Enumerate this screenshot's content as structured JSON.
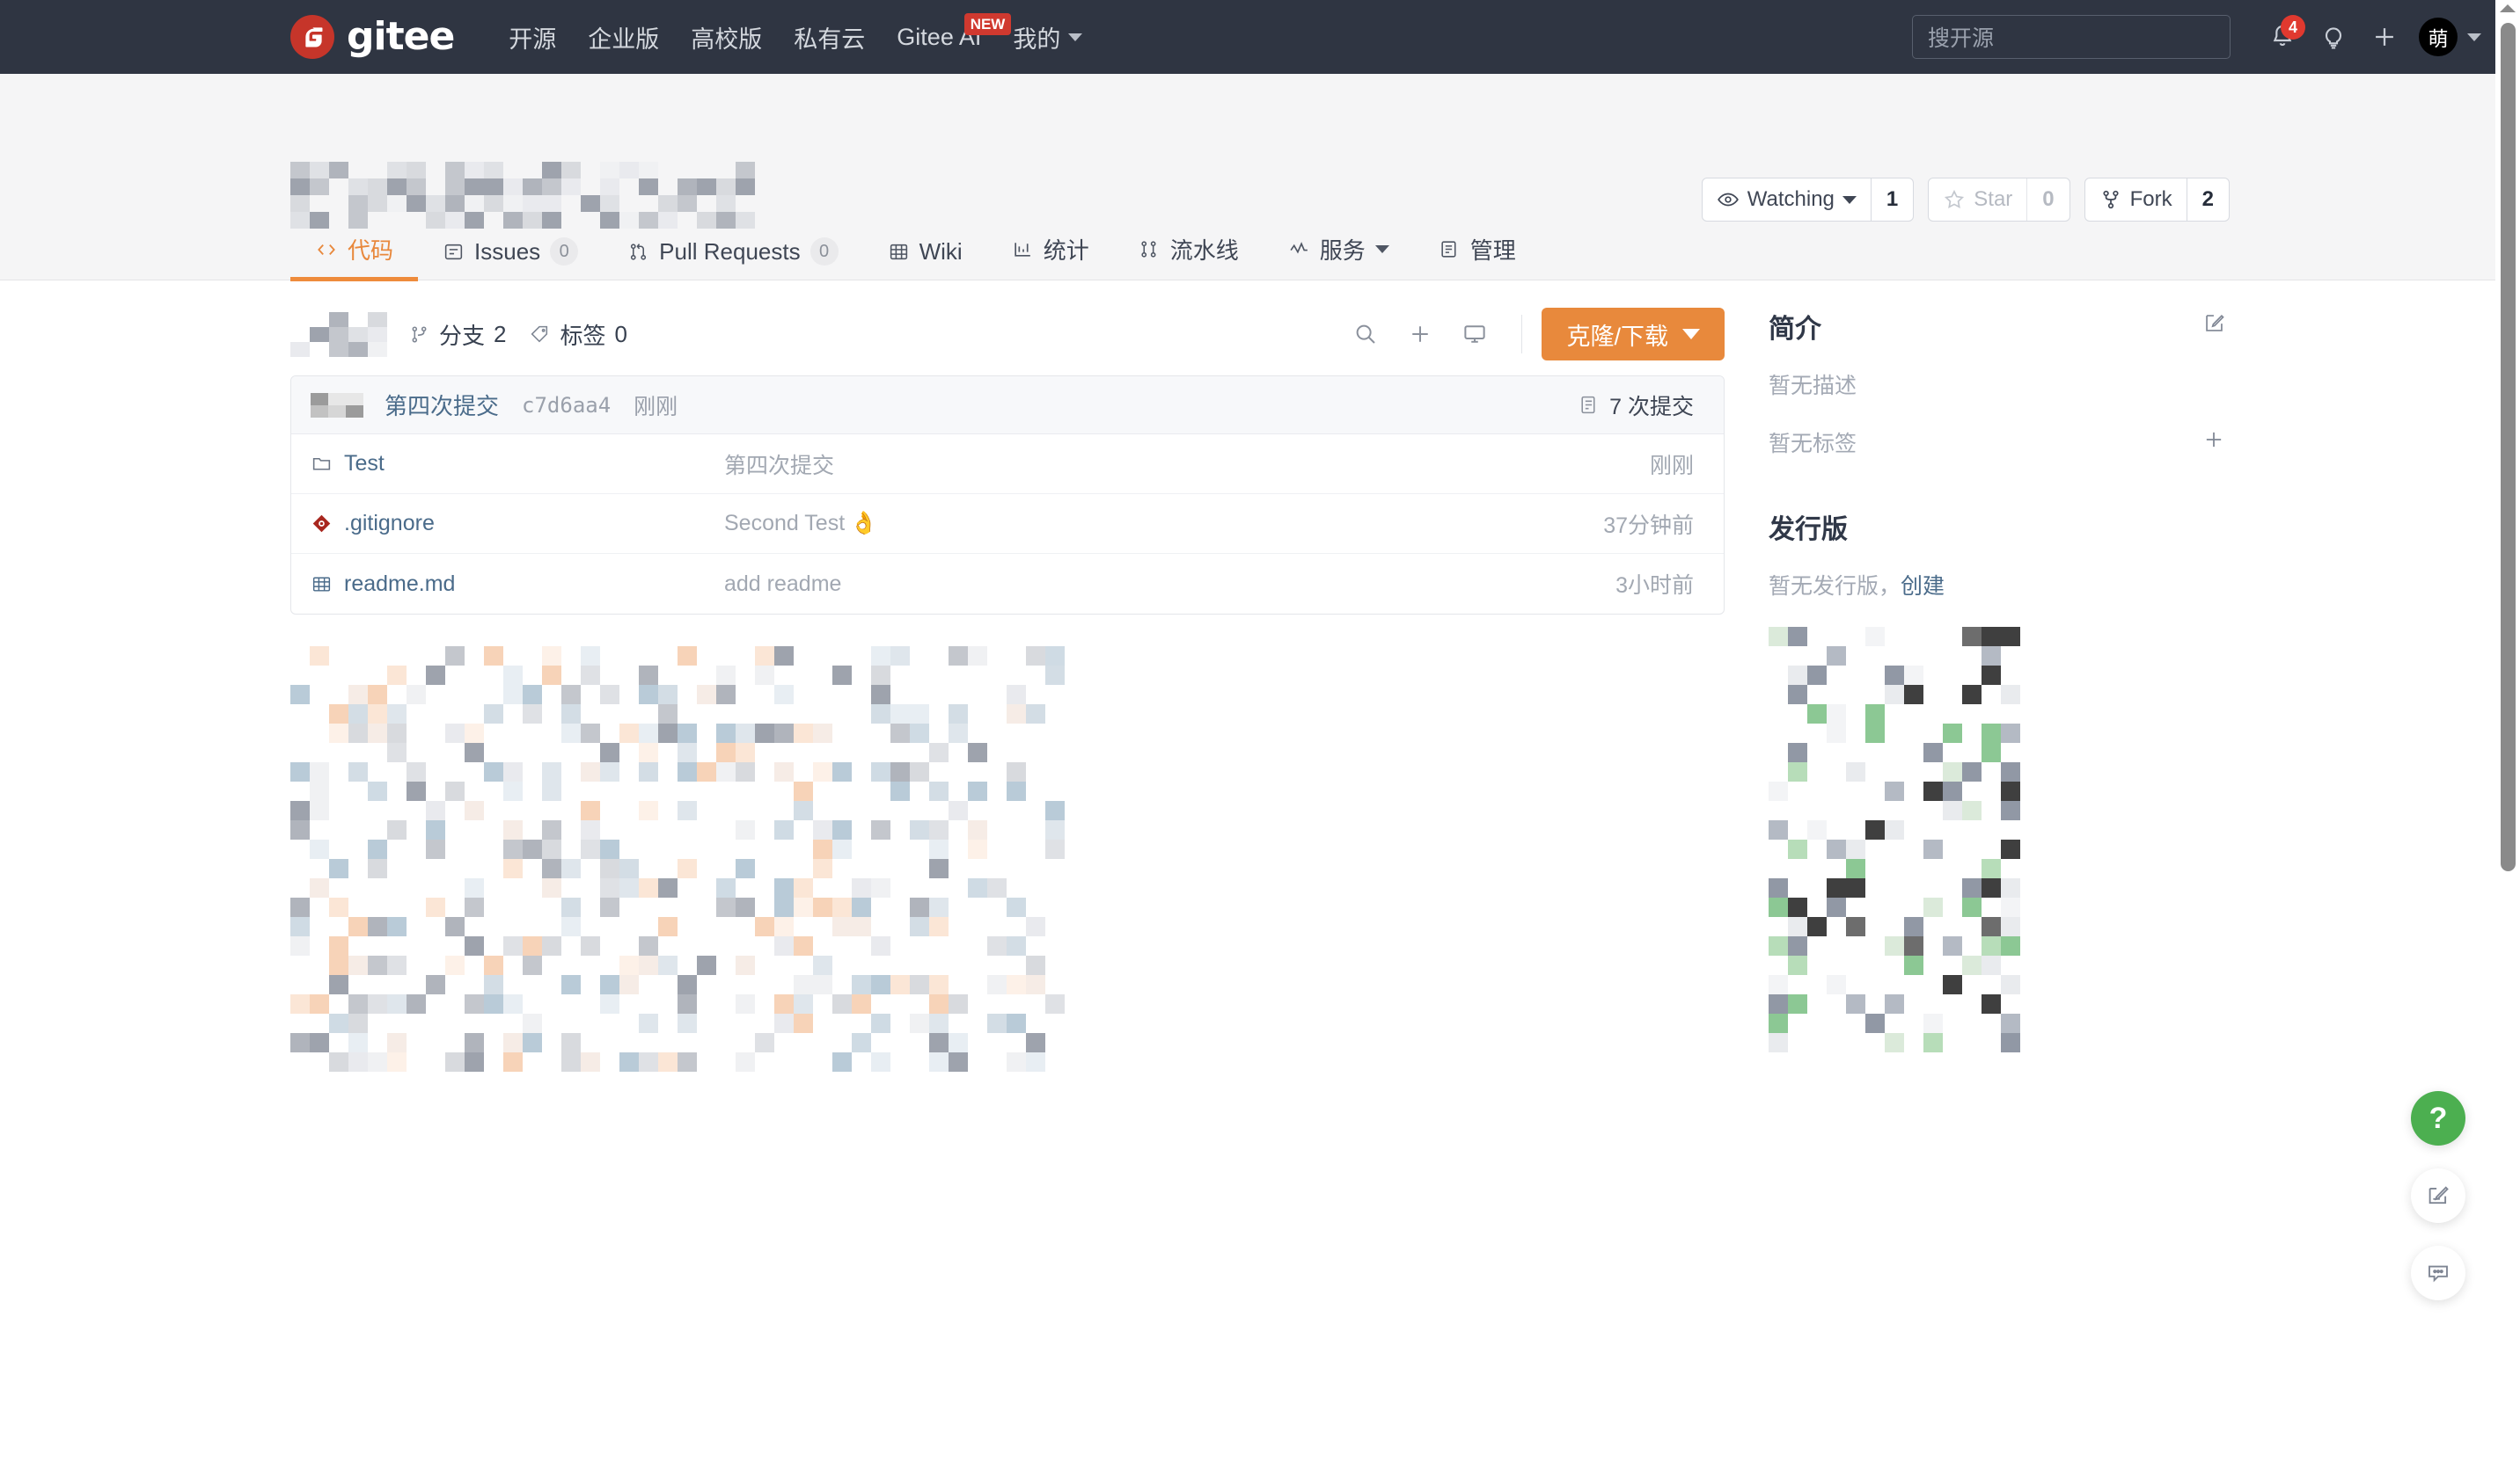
{
  "topnav": {
    "brand": "gitee",
    "links": [
      {
        "label": "开源",
        "badge": null
      },
      {
        "label": "企业版",
        "badge": null
      },
      {
        "label": "高校版",
        "badge": null
      },
      {
        "label": "私有云",
        "badge": null
      },
      {
        "label": "Gitee AI",
        "badge": "NEW"
      },
      {
        "label": "我的",
        "badge": null
      }
    ],
    "search_placeholder": "搜开源",
    "notification_count": "4",
    "avatar_initial": "萌"
  },
  "repo": {
    "title_redacted": true,
    "social": {
      "watch_label": "Watching",
      "watch_count": "1",
      "star_label": "Star",
      "star_count": "0",
      "fork_label": "Fork",
      "fork_count": "2"
    },
    "tabs": [
      {
        "label": "代码",
        "icon": "code-icon",
        "count": null,
        "active": true,
        "caret": false
      },
      {
        "label": "Issues",
        "icon": "issue-icon",
        "count": "0",
        "active": false,
        "caret": false
      },
      {
        "label": "Pull Requests",
        "icon": "pr-icon",
        "count": "0",
        "active": false,
        "caret": false
      },
      {
        "label": "Wiki",
        "icon": "book-icon",
        "count": null,
        "active": false,
        "caret": false
      },
      {
        "label": "统计",
        "icon": "chart-icon",
        "count": null,
        "active": false,
        "caret": false
      },
      {
        "label": "流水线",
        "icon": "pipeline-icon",
        "count": null,
        "active": false,
        "caret": false
      },
      {
        "label": "服务",
        "icon": "service-icon",
        "count": null,
        "active": false,
        "caret": true
      },
      {
        "label": "管理",
        "icon": "manage-icon",
        "count": null,
        "active": false,
        "caret": false
      }
    ]
  },
  "toolbar": {
    "branch_label": "分支",
    "branch_count": "2",
    "tag_label": "标签",
    "tag_count": "0",
    "clone_label": "克隆/下载"
  },
  "commit": {
    "message": "第四次提交",
    "sha": "c7d6aa4",
    "time": "刚刚",
    "count_label": "7 次提交"
  },
  "files": [
    {
      "name": "Test",
      "icon": "folder-icon",
      "message": "第四次提交",
      "emoji": "",
      "time": "刚刚"
    },
    {
      "name": ".gitignore",
      "icon": "git-icon",
      "message": "Second Test",
      "emoji": "👌",
      "time": "37分钟前"
    },
    {
      "name": "readme.md",
      "icon": "markdown-icon",
      "message": "add readme",
      "emoji": "",
      "time": "3小时前"
    }
  ],
  "sidebar": {
    "about_title": "简介",
    "no_description": "暂无描述",
    "no_tags": "暂无标签",
    "release_title": "发行版",
    "no_release": "暂无发行版，",
    "create_link": "创建"
  },
  "fabs": [
    {
      "name": "help-fab",
      "glyph": "?"
    },
    {
      "name": "feedback-fab",
      "glyph": "edit-icon"
    },
    {
      "name": "chat-fab",
      "glyph": "chat-icon"
    }
  ],
  "colors": {
    "header_bg": "#2f3542",
    "accent_orange": "#e8893c",
    "brand_red": "#c6352a",
    "link_blue": "#4a6b8a",
    "fab_green": "#4caf50"
  }
}
